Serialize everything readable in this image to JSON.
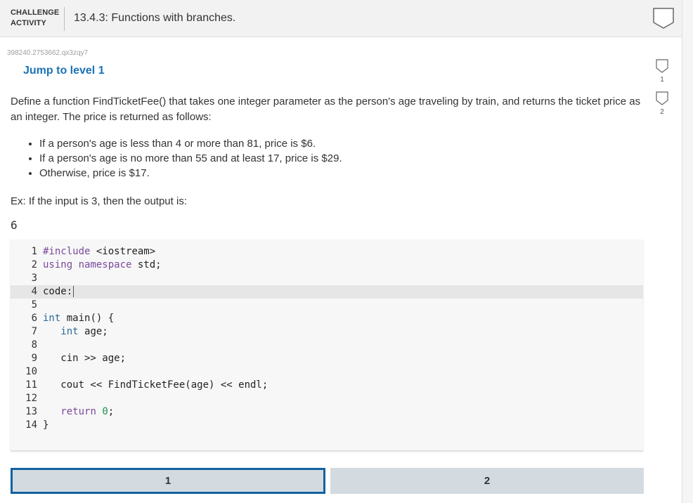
{
  "header": {
    "tag_line1": "CHALLENGE",
    "tag_line2": "ACTIVITY",
    "title": "13.4.3: Functions with branches."
  },
  "activity_id": "398240.2753662.qx3zqy7",
  "jump_link": "Jump to level 1",
  "prompt": "Define a function FindTicketFee() that takes one integer parameter as the person's age traveling by train, and returns the ticket price as an integer. The price is returned as follows:",
  "bullets": [
    "If a person's age is less than 4 or more than 81, price is $6.",
    "If a person's age is no more than 55 and at least 17, price is $29.",
    "Otherwise, price is $17."
  ],
  "example_intro": "Ex: If the input is 3, then the output is:",
  "example_output": "6",
  "code": {
    "active_line": 4,
    "lines": [
      {
        "n": "1",
        "text": "#include <iostream>"
      },
      {
        "n": "2",
        "text": "using namespace std;"
      },
      {
        "n": "3",
        "text": ""
      },
      {
        "n": "4",
        "text": "code:"
      },
      {
        "n": "5",
        "text": ""
      },
      {
        "n": "6",
        "text": "int main() {"
      },
      {
        "n": "7",
        "text": "   int age;"
      },
      {
        "n": "8",
        "text": ""
      },
      {
        "n": "9",
        "text": "   cin >> age;"
      },
      {
        "n": "10",
        "text": ""
      },
      {
        "n": "11",
        "text": "   cout << FindTicketFee(age) << endl;"
      },
      {
        "n": "12",
        "text": ""
      },
      {
        "n": "13",
        "text": "   return 0;"
      },
      {
        "n": "14",
        "text": "}"
      }
    ]
  },
  "levels": [
    {
      "label": "1",
      "current": true
    },
    {
      "label": "2",
      "current": false
    }
  ],
  "side_levels": [
    "1",
    "2"
  ],
  "colors": {
    "link": "#1a73b5",
    "level_bg": "#d3dbe0",
    "level_border": "#1461a0",
    "editor_bg": "#f7f7f7"
  },
  "icons": {
    "header_badge": "shield-outline-icon",
    "level_badge": "shield-outline-icon"
  }
}
